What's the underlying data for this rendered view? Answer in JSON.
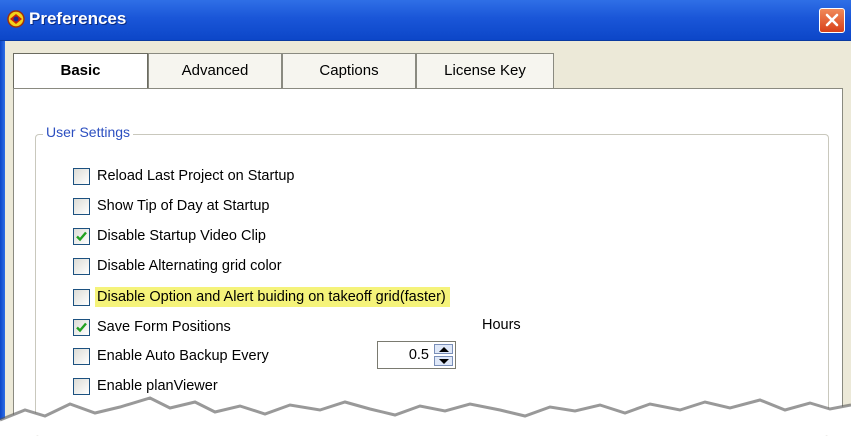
{
  "window": {
    "title": "Preferences",
    "app_icon": "app-logo-icon",
    "close_icon": "close-icon"
  },
  "tabs": [
    {
      "label": "Basic",
      "active": true
    },
    {
      "label": "Advanced",
      "active": false
    },
    {
      "label": "Captions",
      "active": false
    },
    {
      "label": "License Key",
      "active": false
    }
  ],
  "group": {
    "label": "User Settings"
  },
  "options": [
    {
      "label": "Reload Last Project on Startup",
      "checked": false
    },
    {
      "label": "Show Tip of Day at Startup",
      "checked": false
    },
    {
      "label": "Disable Startup Video Clip",
      "checked": true
    },
    {
      "label": "Disable Alternating grid color",
      "checked": false
    },
    {
      "label": "Disable Option and Alert buiding on takeoff grid(faster)",
      "checked": false,
      "highlighted": true
    },
    {
      "label": "Save Form Positions",
      "checked": true
    },
    {
      "label": "Enable Auto Backup Every",
      "checked": false
    },
    {
      "label": "Enable planViewer",
      "checked": false
    }
  ],
  "backup": {
    "value": "0.5",
    "unit_label": "Hours"
  },
  "colors": {
    "titlebar": "#1a56d8",
    "highlight": "#f5f37a",
    "group_label": "#2c4fc0",
    "check": "#21a121"
  }
}
